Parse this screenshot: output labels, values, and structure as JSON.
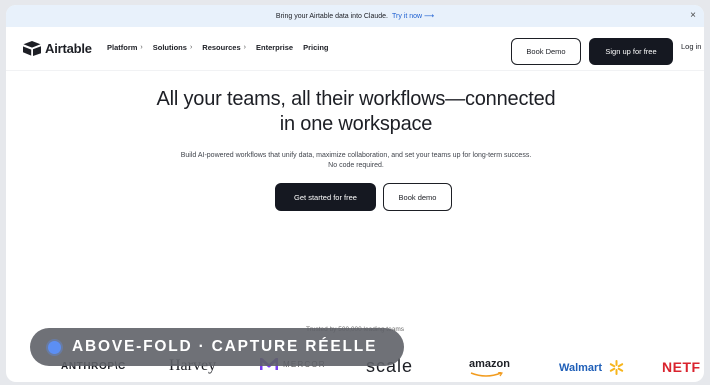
{
  "banner": {
    "text": "Bring your Airtable data into Claude.",
    "link": "Try it now ⟶",
    "close": "×"
  },
  "nav": {
    "logo": "Airtable",
    "menu": [
      {
        "label": "Platform",
        "chevron": "›"
      },
      {
        "label": "Solutions",
        "chevron": "›"
      },
      {
        "label": "Resources",
        "chevron": "›"
      },
      {
        "label": "Enterprise",
        "chevron": ""
      },
      {
        "label": "Pricing",
        "chevron": ""
      }
    ],
    "book_demo": "Book Demo",
    "signup": "Sign up for free",
    "login": "Log in"
  },
  "hero": {
    "title_line1": "All your teams, all their workflows—connected",
    "title_line2": "in one workspace",
    "subtitle_line1": "Build AI-powered workflows that unify data, maximize collaboration, and set your teams up for long-term success.",
    "subtitle_line2": "No code required.",
    "cta_primary": "Get started for free",
    "cta_secondary": "Book demo"
  },
  "trusted": "Trusted by 500,000 leading teams",
  "logos": [
    "ANTHROP\\C",
    "Harvey",
    "MERCOR",
    "scale",
    "amazon",
    "Walmart",
    "NETF"
  ],
  "overlay": {
    "label": "ABOVE-FOLD · CAPTURE RÉELLE"
  },
  "colors": {
    "accent": "#1c5fd1",
    "dark_button": "#151821",
    "banner_bg": "#e8f1fb",
    "overlay_dot": "#5c8ff4"
  }
}
